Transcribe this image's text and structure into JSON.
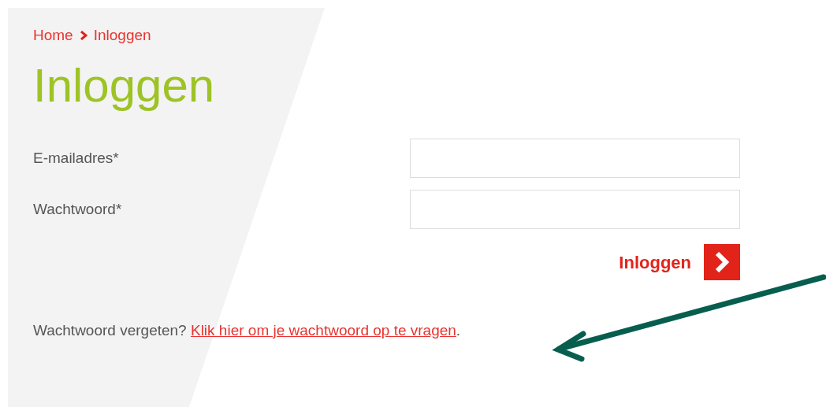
{
  "breadcrumb": [
    {
      "label": "Home"
    },
    {
      "label": "Inloggen"
    }
  ],
  "title": "Inloggen",
  "fields": [
    {
      "label": "E-mailadres*"
    },
    {
      "label": "Wachtwoord*"
    }
  ],
  "submit": {
    "label": "Inloggen"
  },
  "forgot": {
    "text": "Wachtwoord vergeten?",
    "link": "Klik hier om je wachtwoord op te vragen",
    "suffix": "."
  }
}
